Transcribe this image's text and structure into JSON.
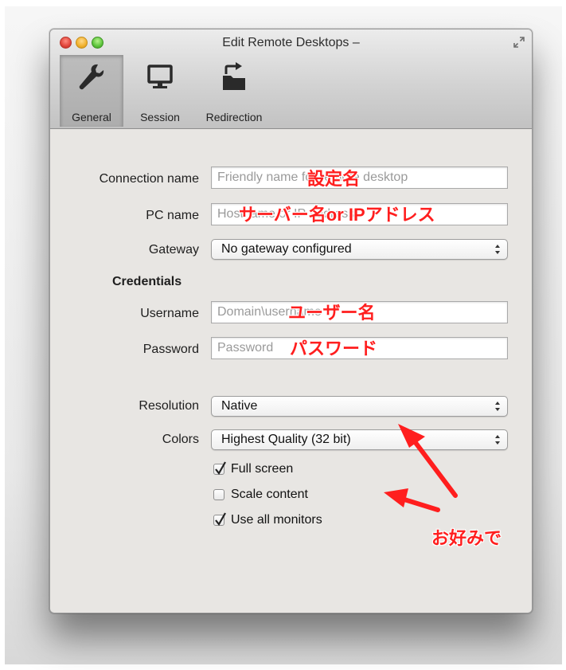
{
  "window": {
    "title": "Edit Remote Desktops –"
  },
  "toolbar": {
    "tabs": [
      {
        "label": "General",
        "icon": "wrench-icon",
        "selected": true
      },
      {
        "label": "Session",
        "icon": "monitor-icon",
        "selected": false
      },
      {
        "label": "Redirection",
        "icon": "redirect-folder-icon",
        "selected": false
      }
    ]
  },
  "form": {
    "connection_name": {
      "label": "Connection name",
      "placeholder": "Friendly name for remote desktop"
    },
    "pc_name": {
      "label": "PC name",
      "placeholder": "Hostname or IP address"
    },
    "gateway": {
      "label": "Gateway",
      "value": "No gateway configured"
    },
    "credentials_heading": "Credentials",
    "username": {
      "label": "Username",
      "placeholder": "Domain\\username"
    },
    "password": {
      "label": "Password",
      "placeholder": "Password"
    },
    "resolution": {
      "label": "Resolution",
      "value": "Native"
    },
    "colors": {
      "label": "Colors",
      "value": "Highest Quality (32 bit)"
    },
    "options": [
      {
        "label": "Full screen",
        "checked": true
      },
      {
        "label": "Scale content",
        "checked": false
      },
      {
        "label": "Use all monitors",
        "checked": true
      }
    ]
  },
  "annotations": {
    "setting_name": "設定名",
    "server_name": "サーバー名or IPアドレス",
    "user_name": "ユーザー名",
    "password": "パスワード",
    "preference": "お好みで"
  },
  "colors": {
    "annotation_red": "#ff1e1e",
    "window_bg": "#e8e6e3"
  }
}
